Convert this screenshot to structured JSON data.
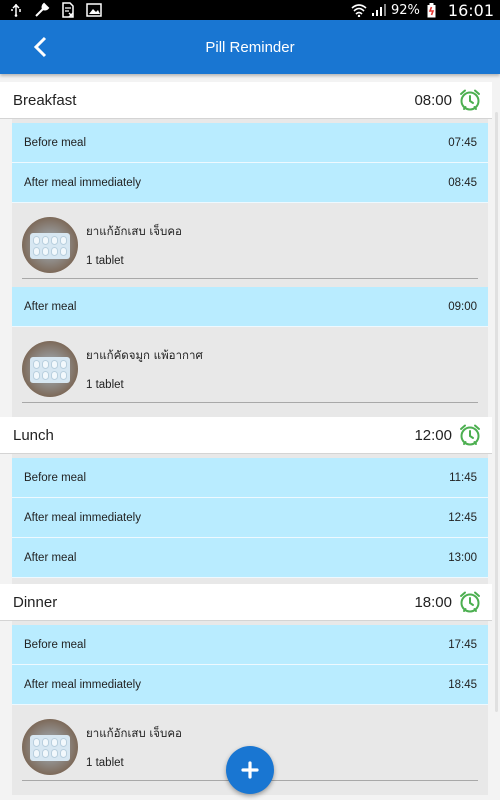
{
  "status_bar": {
    "battery": "92%",
    "time": "16:01",
    "icons": [
      "usb-icon",
      "wrench-icon",
      "file-icon",
      "image-icon",
      "wifi-icon",
      "signal-icon",
      "battery-icon"
    ]
  },
  "app_bar": {
    "title": "Pill Reminder",
    "back_icon": "chevron-left-icon"
  },
  "colors": {
    "primary": "#1976d2",
    "slot_bg": "#b9ecff",
    "card_bg": "#e8e8e8",
    "alarm_green": "#4caf50"
  },
  "meals": [
    {
      "name": "Breakfast",
      "time": "08:00",
      "slots": [
        {
          "label": "Before meal",
          "time": "07:45",
          "meds": []
        },
        {
          "label": "After meal immediately",
          "time": "08:45",
          "meds": [
            {
              "name": "ยาแก้อักเสบ เจ็บคอ",
              "dose": "1 tablet"
            }
          ]
        },
        {
          "label": "After meal",
          "time": "09:00",
          "meds": [
            {
              "name": "ยาแก้คัดจมูก แพ้อากาศ",
              "dose": "1 tablet"
            }
          ]
        }
      ]
    },
    {
      "name": "Lunch",
      "time": "12:00",
      "slots": [
        {
          "label": "Before meal",
          "time": "11:45",
          "meds": []
        },
        {
          "label": "After meal immediately",
          "time": "12:45",
          "meds": []
        },
        {
          "label": "After meal",
          "time": "13:00",
          "meds": []
        }
      ]
    },
    {
      "name": "Dinner",
      "time": "18:00",
      "slots": [
        {
          "label": "Before meal",
          "time": "17:45",
          "meds": []
        },
        {
          "label": "After meal immediately",
          "time": "18:45",
          "meds": [
            {
              "name": "ยาแก้อักเสบ เจ็บคอ",
              "dose": "1 tablet"
            }
          ]
        }
      ]
    }
  ],
  "fab": {
    "icon": "plus-icon"
  }
}
